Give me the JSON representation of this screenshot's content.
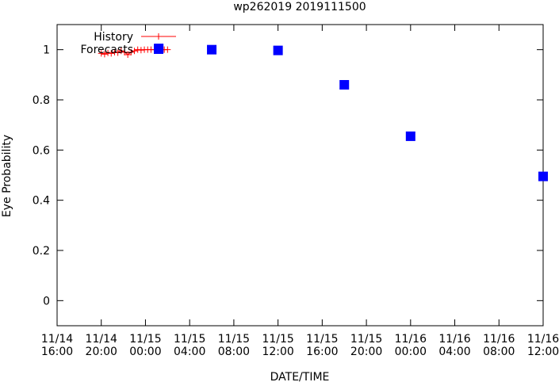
{
  "chart_data": {
    "type": "scatter",
    "title": "wp262019 2019111500",
    "xlabel": "DATE/TIME",
    "ylabel": "Eye Probability",
    "x_axis": "hours since 11/14 16:00",
    "xlim": [
      0,
      44
    ],
    "ylim": [
      -0.1,
      1.1
    ],
    "x_ticks": [
      {
        "x": 0,
        "line1": "11/14",
        "line2": "16:00"
      },
      {
        "x": 4,
        "line1": "11/14",
        "line2": "20:00"
      },
      {
        "x": 8,
        "line1": "11/15",
        "line2": "00:00"
      },
      {
        "x": 12,
        "line1": "11/15",
        "line2": "04:00"
      },
      {
        "x": 16,
        "line1": "11/15",
        "line2": "08:00"
      },
      {
        "x": 20,
        "line1": "11/15",
        "line2": "12:00"
      },
      {
        "x": 24,
        "line1": "11/15",
        "line2": "16:00"
      },
      {
        "x": 28,
        "line1": "11/15",
        "line2": "20:00"
      },
      {
        "x": 32,
        "line1": "11/16",
        "line2": "00:00"
      },
      {
        "x": 36,
        "line1": "11/16",
        "line2": "04:00"
      },
      {
        "x": 40,
        "line1": "11/16",
        "line2": "08:00"
      },
      {
        "x": 44,
        "line1": "11/16",
        "line2": "12:00"
      }
    ],
    "y_ticks": [
      {
        "y": 0,
        "label": "0"
      },
      {
        "y": 0.2,
        "label": "0.2"
      },
      {
        "y": 0.4,
        "label": "0.4"
      },
      {
        "y": 0.6,
        "label": "0.6"
      },
      {
        "y": 0.8,
        "label": "0.8"
      },
      {
        "y": 1.0,
        "label": "1"
      }
    ],
    "legend_position": "top-left",
    "grid": false,
    "series": [
      {
        "name": "History",
        "style": "line-points",
        "marker": "plus",
        "color": "#ff0000",
        "x": [
          4.0,
          4.3,
          4.6,
          4.9,
          5.2,
          5.5,
          5.8,
          6.1,
          6.4,
          6.7,
          7.0,
          7.3,
          7.6,
          7.9,
          8.2,
          8.5,
          8.8,
          9.1,
          9.4,
          9.7,
          10.0
        ],
        "y": [
          0.985,
          0.982,
          0.987,
          0.985,
          0.99,
          0.988,
          0.995,
          0.99,
          0.98,
          0.99,
          0.995,
          1.0,
          0.998,
          1.0,
          1.0,
          1.0,
          1.0,
          1.0,
          1.0,
          1.0,
          1.0
        ]
      },
      {
        "name": "Forecasts",
        "style": "points",
        "marker": "square",
        "color": "#0000ff",
        "x": [
          9.2,
          14,
          20,
          26,
          32,
          44
        ],
        "y": [
          1.005,
          1.0,
          0.997,
          0.86,
          0.655,
          0.495
        ]
      }
    ]
  }
}
